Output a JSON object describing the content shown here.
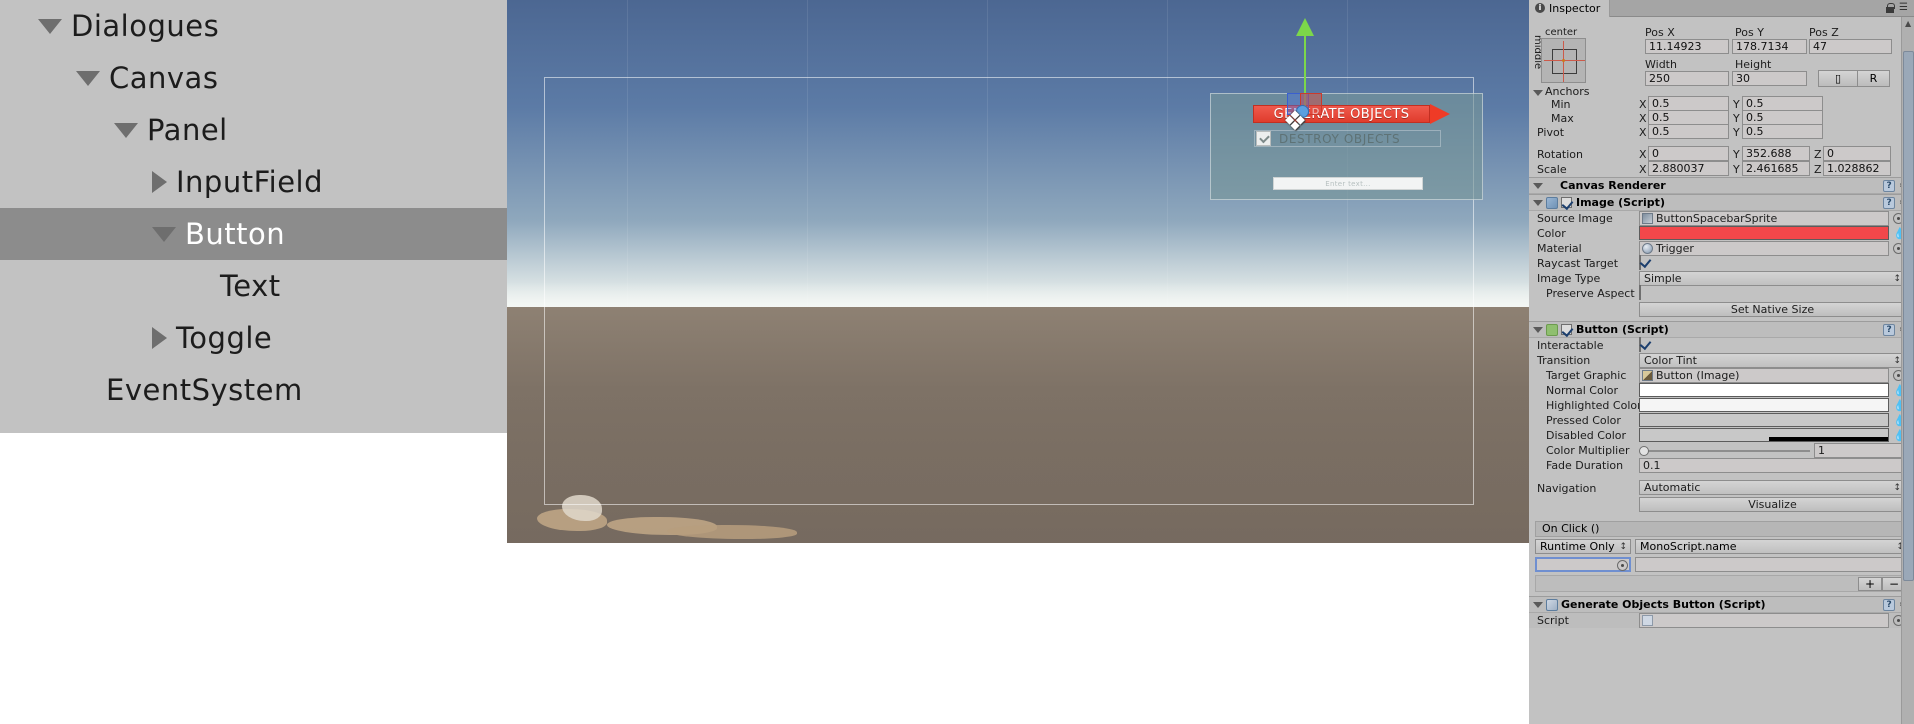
{
  "hierarchy": {
    "items": [
      {
        "label": "Dialogues",
        "indent": 1,
        "arrow": "down",
        "selected": false
      },
      {
        "label": "Canvas",
        "indent": 2,
        "arrow": "down",
        "selected": false
      },
      {
        "label": "Panel",
        "indent": 3,
        "arrow": "down",
        "selected": false
      },
      {
        "label": "InputField",
        "indent": 4,
        "arrow": "right",
        "selected": false
      },
      {
        "label": "Button",
        "indent": 4,
        "arrow": "down",
        "selected": true
      },
      {
        "label": "Text",
        "indent": 5,
        "arrow": "none",
        "selected": false
      },
      {
        "label": "Toggle",
        "indent": 4,
        "arrow": "right",
        "selected": false
      },
      {
        "label": "EventSystem",
        "indent": 2,
        "arrow": "none",
        "selected": false
      }
    ]
  },
  "scene": {
    "ui_button_generate": "GENERATE OBJECTS",
    "ui_toggle_destroy": "DESTROY OBJECTS",
    "ui_inputfield_placeholder": "Enter text..."
  },
  "inspector": {
    "tab_label": "Inspector",
    "rect_transform": {
      "anchor_preset_label": "center",
      "anchor_preset_vlabel": "middle",
      "pos_x_label": "Pos X",
      "pos_y_label": "Pos Y",
      "pos_z_label": "Pos Z",
      "pos_x": "11.14923",
      "pos_y": "178.7134",
      "pos_z": "47",
      "width_label": "Width",
      "height_label": "Height",
      "width": "250",
      "height": "30",
      "blueprint_label": "R",
      "anchors_label": "Anchors",
      "min_label": "Min",
      "max_label": "Max",
      "pivot_label": "Pivot",
      "rotation_label": "Rotation",
      "scale_label": "Scale",
      "x_axis": "X",
      "y_axis": "Y",
      "z_axis": "Z",
      "anchor_min_x": "0.5",
      "anchor_min_y": "0.5",
      "anchor_max_x": "0.5",
      "anchor_max_y": "0.5",
      "pivot_x": "0.5",
      "pivot_y": "0.5",
      "rot_x": "0",
      "rot_y": "352.688",
      "rot_z": "0",
      "scale_x": "2.880037",
      "scale_y": "2.461685",
      "scale_z": "1.028862"
    },
    "canvas_renderer": {
      "title": "Canvas Renderer"
    },
    "image_script": {
      "title": "Image (Script)",
      "enabled": true,
      "source_image_label": "Source Image",
      "source_image_value": "ButtonSpacebarSprite",
      "color_label": "Color",
      "color_value": "#f2474a",
      "material_label": "Material",
      "material_value": "Trigger",
      "raycast_target_label": "Raycast Target",
      "raycast_target_checked": true,
      "image_type_label": "Image Type",
      "image_type_value": "Simple",
      "preserve_aspect_label": "Preserve Aspect",
      "preserve_aspect_checked": false,
      "set_native_size_label": "Set Native Size"
    },
    "button_script": {
      "title": "Button (Script)",
      "enabled": true,
      "interactable_label": "Interactable",
      "interactable_checked": true,
      "transition_label": "Transition",
      "transition_value": "Color Tint",
      "target_graphic_label": "Target Graphic",
      "target_graphic_value": "Button (Image)",
      "normal_color_label": "Normal Color",
      "normal_color_value": "#ffffff",
      "highlighted_color_label": "Highlighted Color",
      "highlighted_color_value": "#f5f5f5",
      "pressed_color_label": "Pressed Color",
      "pressed_color_value": "#c8c8c8",
      "disabled_color_label": "Disabled Color",
      "disabled_color_value": "#c8c8c8",
      "color_multiplier_label": "Color Multiplier",
      "color_multiplier_value": "1",
      "fade_duration_label": "Fade Duration",
      "fade_duration_value": "0.1",
      "navigation_label": "Navigation",
      "navigation_value": "Automatic",
      "visualize_label": "Visualize",
      "on_click_label": "On Click ()",
      "event_mode": "Runtime Only",
      "event_function": "MonoScript.name",
      "plus_label": "+",
      "minus_label": "−"
    },
    "generate_objects_script": {
      "title": "Generate Objects Button (Script)",
      "script_label": "Script",
      "script_value": ""
    }
  }
}
